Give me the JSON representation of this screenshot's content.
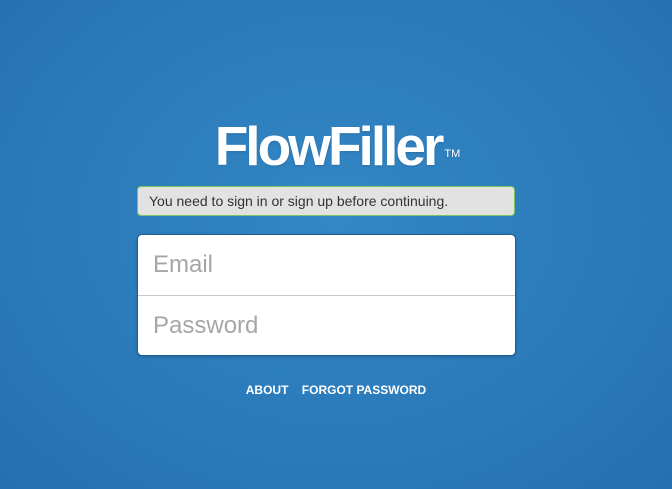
{
  "brand": {
    "name": "FlowFiller",
    "trademark": "TM"
  },
  "flash": {
    "message": "You need to sign in or sign up before continuing."
  },
  "login_form": {
    "email_placeholder": "Email",
    "email_value": "",
    "password_placeholder": "Password",
    "password_value": ""
  },
  "footer_links": {
    "about": "ABOUT",
    "forgot_password": "FORGOT PASSWORD"
  },
  "colors": {
    "background": "#2b7bbb",
    "flash_border": "#7cc45f",
    "flash_background": "#e2e2e2"
  }
}
